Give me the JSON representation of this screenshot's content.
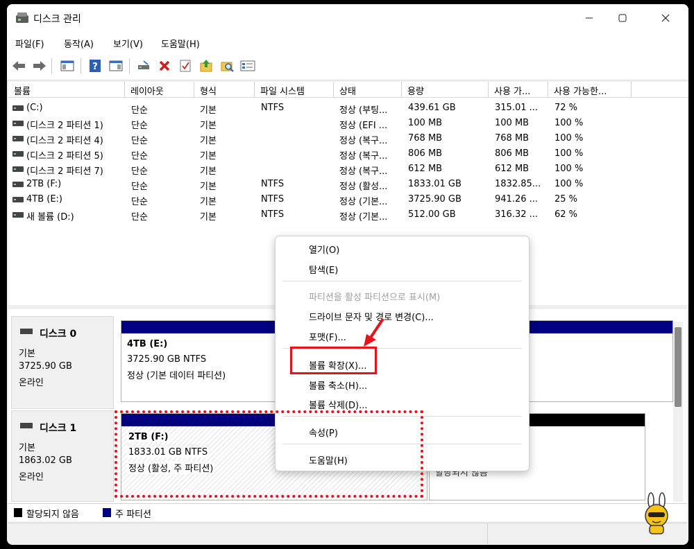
{
  "window": {
    "title": "디스크 관리",
    "controls": [
      "minimize",
      "maximize",
      "close"
    ]
  },
  "menu": [
    "파일(F)",
    "동작(A)",
    "보기(V)",
    "도움말(H)"
  ],
  "toolbar": {
    "icons": [
      "back-icon",
      "forward-icon",
      "console-tree-icon",
      "help-icon",
      "action-pane-icon",
      "connect-drive-icon",
      "delete-icon",
      "check-icon",
      "folder-up-icon",
      "search-folder-icon",
      "properties-icon"
    ]
  },
  "volumes": {
    "columns": [
      "볼륨",
      "레이아웃",
      "형식",
      "파일 시스템",
      "상태",
      "용량",
      "사용 가...",
      "사용 가능한..."
    ],
    "rows": [
      {
        "volume": "(C:)",
        "layout": "단순",
        "type": "기본",
        "fs": "NTFS",
        "status": "정상 (부팅...",
        "capacity": "439.61 GB",
        "free": "315.01 ...",
        "pct": "72 %"
      },
      {
        "volume": "(디스크 2 파티션 1)",
        "layout": "단순",
        "type": "기본",
        "fs": "",
        "status": "정상 (EFI ...",
        "capacity": "100 MB",
        "free": "100 MB",
        "pct": "100 %"
      },
      {
        "volume": "(디스크 2 파티션 4)",
        "layout": "단순",
        "type": "기본",
        "fs": "",
        "status": "정상 (복구...",
        "capacity": "768 MB",
        "free": "768 MB",
        "pct": "100 %"
      },
      {
        "volume": "(디스크 2 파티션 5)",
        "layout": "단순",
        "type": "기본",
        "fs": "",
        "status": "정상 (복구...",
        "capacity": "806 MB",
        "free": "806 MB",
        "pct": "100 %"
      },
      {
        "volume": "(디스크 2 파티션 7)",
        "layout": "단순",
        "type": "기본",
        "fs": "",
        "status": "정상 (복구...",
        "capacity": "612 MB",
        "free": "612 MB",
        "pct": "100 %"
      },
      {
        "volume": "2TB (F:)",
        "layout": "단순",
        "type": "기본",
        "fs": "NTFS",
        "status": "정상 (활성...",
        "capacity": "1833.01 GB",
        "free": "1832.85...",
        "pct": "100 %"
      },
      {
        "volume": "4TB (E:)",
        "layout": "단순",
        "type": "기본",
        "fs": "NTFS",
        "status": "정상 (기본...",
        "capacity": "3725.90 GB",
        "free": "941.26 ...",
        "pct": "25 %"
      },
      {
        "volume": "새 볼륨 (D:)",
        "layout": "단순",
        "type": "기본",
        "fs": "NTFS",
        "status": "정상 (기본...",
        "capacity": "512.00 GB",
        "free": "316.32 ...",
        "pct": "62 %"
      }
    ]
  },
  "disks": [
    {
      "name": "디스크 0",
      "kind": "기본",
      "size": "3725.90 GB",
      "state": "온라인",
      "partition": {
        "title": "4TB  (E:)",
        "detail": "3725.90 GB NTFS",
        "status": "정상 (기본 데이터 파티션)"
      }
    },
    {
      "name": "디스크 1",
      "kind": "기본",
      "size": "1863.02 GB",
      "state": "온라인",
      "partition": {
        "title": "2TB  (F:)",
        "detail": "1833.01 GB NTFS",
        "status": "정상 (활성, 주 파티션)"
      },
      "unallocated_partial": "할당되지 않음"
    }
  ],
  "legend": [
    {
      "label": "할당되지 않음",
      "color": "#000000"
    },
    {
      "label": "주 파티션",
      "color": "#000080"
    }
  ],
  "context_menu": {
    "items": [
      {
        "label": "열기(O)",
        "enabled": true
      },
      {
        "label": "탐색(E)",
        "enabled": true
      },
      {
        "label": "파티션을 활성 파티션으로 표시(M)",
        "enabled": false
      },
      {
        "label": "드라이브 문자 및 경로 변경(C)...",
        "enabled": true
      },
      {
        "label": "포맷(F)...",
        "enabled": true
      },
      {
        "label": "볼륨 확장(X)...",
        "enabled": true
      },
      {
        "label": "볼륨 축소(H)...",
        "enabled": true
      },
      {
        "label": "볼륨 삭제(D)...",
        "enabled": true
      },
      {
        "label": "속성(P)",
        "enabled": true
      },
      {
        "label": "도움말(H)",
        "enabled": true
      }
    ]
  },
  "colors": {
    "primary_partition": "#000080",
    "unallocated": "#000000",
    "highlight": "#e5121a"
  }
}
